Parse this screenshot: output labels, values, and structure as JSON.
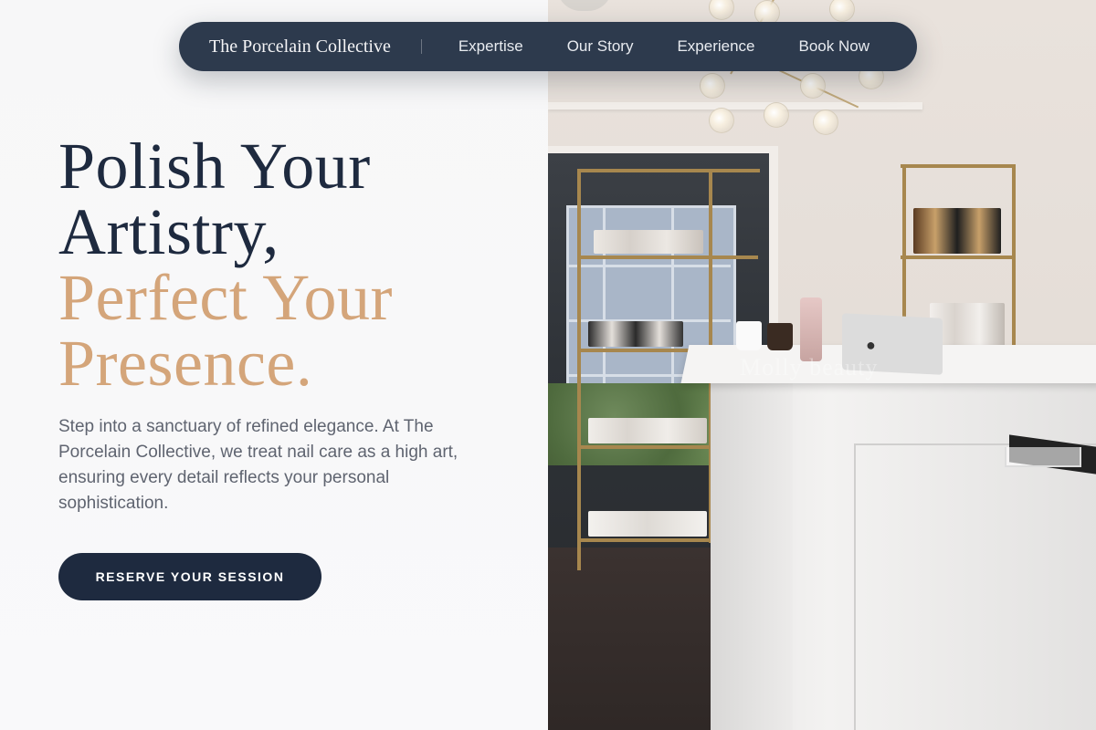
{
  "nav": {
    "brand": "The Porcelain Collective",
    "links": [
      "Expertise",
      "Our Story",
      "Experience",
      "Book Now"
    ]
  },
  "hero": {
    "headline_line1": "Polish Your",
    "headline_line2": "Artistry,",
    "headline_line3": "Perfect Your",
    "headline_line4": "Presence.",
    "lead": "Step into a sanctuary of refined elegance. At The Porcelain Collective, we treat nail care as a high art, ensuring every detail reflects your personal sophistication.",
    "cta_label": "RESERVE YOUR SESSION"
  },
  "photo": {
    "watermark": "Molly beauty"
  },
  "colors": {
    "navy": "#1e2a3f",
    "nav_bg": "#2d3a4d",
    "gold": "#d4a57a",
    "body_text": "#5f6470",
    "background": "#f7f7f8"
  }
}
